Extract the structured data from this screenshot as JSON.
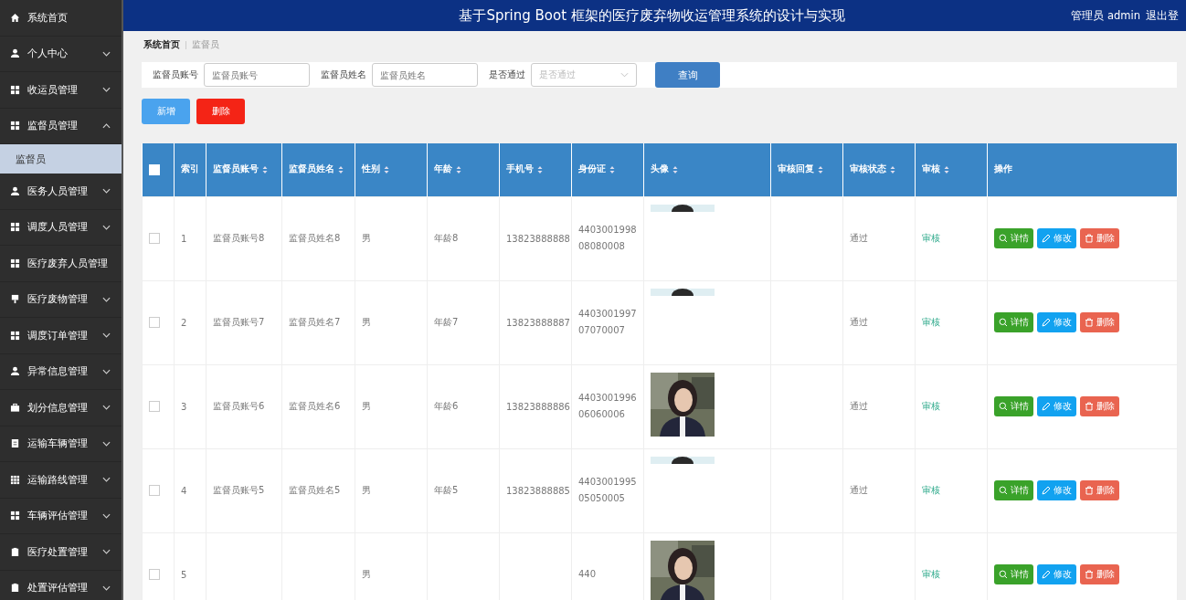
{
  "sidebar": {
    "items": [
      {
        "label": "系统首页",
        "kind": "home"
      },
      {
        "label": "个人中心",
        "kind": "user",
        "expanded": false
      },
      {
        "label": "收运员管理",
        "kind": "grid",
        "expanded": false
      },
      {
        "label": "监督员管理",
        "kind": "grid",
        "expanded": true,
        "children": [
          {
            "label": "监督员",
            "selected": true
          }
        ]
      },
      {
        "label": "医务人员管理",
        "kind": "user",
        "expanded": false
      },
      {
        "label": "调度人员管理",
        "kind": "grid",
        "expanded": false
      },
      {
        "label": "医疗废弃人员管理",
        "kind": "grid"
      },
      {
        "label": "医疗废物管理",
        "kind": "pin",
        "expanded": false
      },
      {
        "label": "调度订单管理",
        "kind": "grid",
        "expanded": false
      },
      {
        "label": "异常信息管理",
        "kind": "user",
        "expanded": false
      },
      {
        "label": "划分信息管理",
        "kind": "case",
        "expanded": false
      },
      {
        "label": "运输车辆管理",
        "kind": "doc",
        "expanded": false
      },
      {
        "label": "运输路线管理",
        "kind": "table",
        "expanded": false
      },
      {
        "label": "车辆评估管理",
        "kind": "grid",
        "expanded": false
      },
      {
        "label": "医疗处置管理",
        "kind": "clip",
        "expanded": false
      },
      {
        "label": "处置评估管理",
        "kind": "clip",
        "expanded": false
      }
    ]
  },
  "header": {
    "title": "基于Spring Boot 框架的医疗废弃物收运管理系统的设计与实现",
    "user": "管理员 admin",
    "logout": "退出登"
  },
  "breadcrumb": [
    "系统首页",
    "监督员"
  ],
  "search": {
    "fields": [
      {
        "label": "监督员账号",
        "placeholder": "监督员账号",
        "kind": "text"
      },
      {
        "label": "监督员姓名",
        "placeholder": "监督员姓名",
        "kind": "text"
      },
      {
        "label": "是否通过",
        "placeholder": "是否通过",
        "kind": "select"
      }
    ],
    "button": "查询"
  },
  "actions": [
    {
      "label": "新增",
      "kind": "add"
    },
    {
      "label": "删除",
      "kind": "delete"
    }
  ],
  "table": {
    "select_all_checked": false,
    "columns": [
      {
        "label": "索引",
        "sortable": false
      },
      {
        "label": "监督员账号",
        "sortable": true
      },
      {
        "label": "监督员姓名",
        "sortable": true
      },
      {
        "label": "性别",
        "sortable": true
      },
      {
        "label": "年龄",
        "sortable": true
      },
      {
        "label": "手机号",
        "sortable": true
      },
      {
        "label": "身份证",
        "sortable": true
      },
      {
        "label": "头像",
        "sortable": true
      },
      {
        "label": "审核回复",
        "sortable": true
      },
      {
        "label": "审核状态",
        "sortable": true
      },
      {
        "label": "审核",
        "sortable": true
      },
      {
        "label": "操作",
        "sortable": false
      }
    ],
    "rows": [
      {
        "checked": false,
        "cells": [
          "1",
          "监督员账号8",
          "监督员姓名8",
          "男",
          "年龄8",
          "13823888888",
          "440300199808080008"
        ],
        "avatar": {
          "kind": "strip"
        },
        "status": "通过",
        "review": "审核",
        "buttons": [
          "详情",
          "修改",
          "删除"
        ]
      },
      {
        "checked": false,
        "cells": [
          "2",
          "监督员账号7",
          "监督员姓名7",
          "男",
          "年龄7",
          "13823888887",
          "440300199707070007"
        ],
        "avatar": {
          "kind": "strip"
        },
        "status": "通过",
        "review": "审核",
        "buttons": [
          "详情",
          "修改",
          "删除"
        ]
      },
      {
        "checked": false,
        "cells": [
          "3",
          "监督员账号6",
          "监督员姓名6",
          "男",
          "年龄6",
          "13823888886",
          "440300199606060006"
        ],
        "status": "通过",
        "review": "审核",
        "buttons": [
          "详情",
          "修改",
          "删除"
        ]
      },
      {
        "checked": false,
        "cells": [
          "4",
          "监督员账号5",
          "监督员姓名5",
          "男",
          "年龄5",
          "13823888885",
          "440300199505050005"
        ],
        "avatar": {
          "kind": "strip"
        },
        "status": "通过",
        "review": "审核",
        "buttons": [
          "详情",
          "修改",
          "删除"
        ]
      },
      {
        "checked": false,
        "cells": [
          "5",
          "",
          "",
          "男",
          "",
          "",
          "440"
        ],
        "status": "",
        "review": "审核",
        "buttons": [
          "详情",
          "修改",
          "删除"
        ]
      }
    ]
  }
}
